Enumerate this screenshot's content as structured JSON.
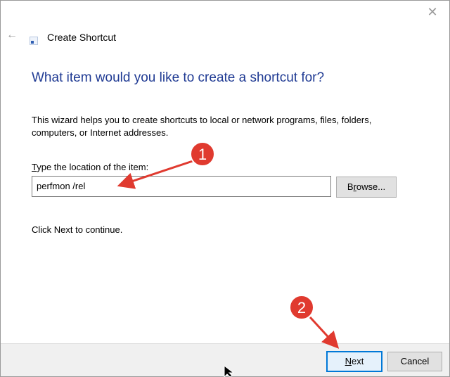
{
  "window": {
    "title": "Create Shortcut",
    "close_icon": "close-icon",
    "back_icon": "back-arrow-icon",
    "app_icon": "shortcut-icon"
  },
  "main": {
    "heading": "What item would you like to create a shortcut for?",
    "description": "This wizard helps you to create shortcuts to local or network programs, files, folders, computers, or Internet addresses.",
    "field_label_prefix": "",
    "field_label_accel": "T",
    "field_label_rest": "ype the location of the item:",
    "location_value": "perfmon /rel",
    "browse_accel": "r",
    "browse_prefix": "B",
    "browse_rest": "owse...",
    "hint": "Click Next to continue."
  },
  "footer": {
    "next_accel": "N",
    "next_rest": "ext",
    "cancel_label": "Cancel"
  },
  "annotations": {
    "badge_1": "1",
    "badge_2": "2",
    "color": "#e03a2f"
  },
  "colors": {
    "heading": "#1f3a93",
    "accent": "#0078d7",
    "footer_bg": "#f0f0f0"
  }
}
